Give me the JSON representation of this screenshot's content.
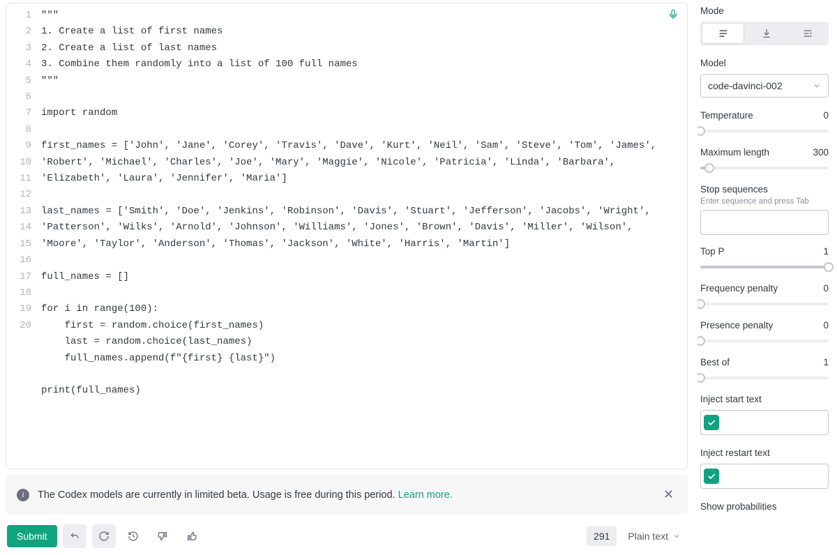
{
  "editor": {
    "lines": [
      "\"\"\"",
      "1. Create a list of first names",
      "2. Create a list of last names",
      "3. Combine them randomly into a list of 100 full names",
      "\"\"\"",
      "",
      "import random",
      "",
      "first_names = ['John', 'Jane', 'Corey', 'Travis', 'Dave', 'Kurt', 'Neil', 'Sam', 'Steve', 'Tom', 'James', 'Robert', 'Michael', 'Charles', 'Joe', 'Mary', 'Maggie', 'Nicole', 'Patricia', 'Linda', 'Barbara', 'Elizabeth', 'Laura', 'Jennifer', 'Maria']",
      "",
      "last_names = ['Smith', 'Doe', 'Jenkins', 'Robinson', 'Davis', 'Stuart', 'Jefferson', 'Jacobs', 'Wright', 'Patterson', 'Wilks', 'Arnold', 'Johnson', 'Williams', 'Jones', 'Brown', 'Davis', 'Miller', 'Wilson', 'Moore', 'Taylor', 'Anderson', 'Thomas', 'Jackson', 'White', 'Harris', 'Martin']",
      "",
      "full_names = []",
      "",
      "for i in range(100):",
      "    first = random.choice(first_names)",
      "    last = random.choice(last_names)",
      "    full_names.append(f\"{first} {last}\")",
      "",
      "print(full_names)"
    ]
  },
  "banner": {
    "text": "The Codex models are currently in limited beta. Usage is free during this period. ",
    "link": "Learn more."
  },
  "bottom": {
    "submit": "Submit",
    "token_count": "291",
    "format": "Plain text"
  },
  "sidebar": {
    "mode_label": "Mode",
    "model_label": "Model",
    "model_value": "code-davinci-002",
    "temperature": {
      "label": "Temperature",
      "value": "0",
      "pct": 0
    },
    "max_length": {
      "label": "Maximum length",
      "value": "300",
      "pct": 7
    },
    "stop": {
      "label": "Stop sequences",
      "hint": "Enter sequence and press Tab"
    },
    "top_p": {
      "label": "Top P",
      "value": "1",
      "pct": 100
    },
    "freq": {
      "label": "Frequency penalty",
      "value": "0",
      "pct": 0
    },
    "pres": {
      "label": "Presence penalty",
      "value": "0",
      "pct": 0
    },
    "best": {
      "label": "Best of",
      "value": "1",
      "pct": 0
    },
    "inject_start": "Inject start text",
    "inject_restart": "Inject restart text",
    "show_prob": "Show probabilities"
  }
}
